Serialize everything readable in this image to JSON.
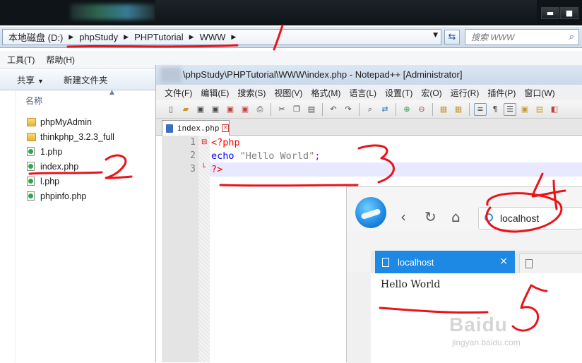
{
  "explorer": {
    "title_buttons": {
      "minimize": "▬",
      "maximize": "■"
    },
    "breadcrumbs": [
      "本地磁盘 (D:)",
      "phpStudy",
      "PHPTutorial",
      "WWW"
    ],
    "search_placeholder": "搜索 WWW",
    "menu": [
      "工具(T)",
      "帮助(H)"
    ],
    "commands": {
      "share": "共享",
      "new_folder": "新建文件夹"
    },
    "column_header": "名称",
    "files": [
      {
        "name": "phpMyAdmin",
        "type": "folder"
      },
      {
        "name": "thinkphp_3.2.3_full",
        "type": "folder"
      },
      {
        "name": "1.php",
        "type": "php"
      },
      {
        "name": "index.php",
        "type": "php"
      },
      {
        "name": "l.php",
        "type": "php"
      },
      {
        "name": "phpinfo.php",
        "type": "php"
      }
    ]
  },
  "notepad": {
    "title": "\\phpStudy\\PHPTutorial\\WWW\\index.php - Notepad++ [Administrator]",
    "menu": [
      "文件(F)",
      "编辑(E)",
      "搜索(S)",
      "视图(V)",
      "格式(M)",
      "语言(L)",
      "设置(T)",
      "宏(O)",
      "运行(R)",
      "插件(P)",
      "窗口(W)"
    ],
    "tab_label": "index.php",
    "lines": [
      {
        "num": "1",
        "code": "<?php"
      },
      {
        "num": "2",
        "code_kw": "echo",
        "code_str": "\"Hello World\"",
        "code_op": ";"
      },
      {
        "num": "3",
        "code": "?>"
      }
    ]
  },
  "browser": {
    "url": "localhost",
    "active_tab": "localhost",
    "page_text": "Hello World"
  },
  "annotations": [
    "1",
    "2",
    "3",
    "4",
    "5"
  ],
  "watermark": {
    "brand": "Baidu",
    "sub": "jingyan.baidu.com"
  },
  "colors": {
    "annotation_red": "#e8141a",
    "browser_accent": "#1e88e5",
    "php_tag": "#ff0000",
    "keyword": "#0000ff"
  }
}
